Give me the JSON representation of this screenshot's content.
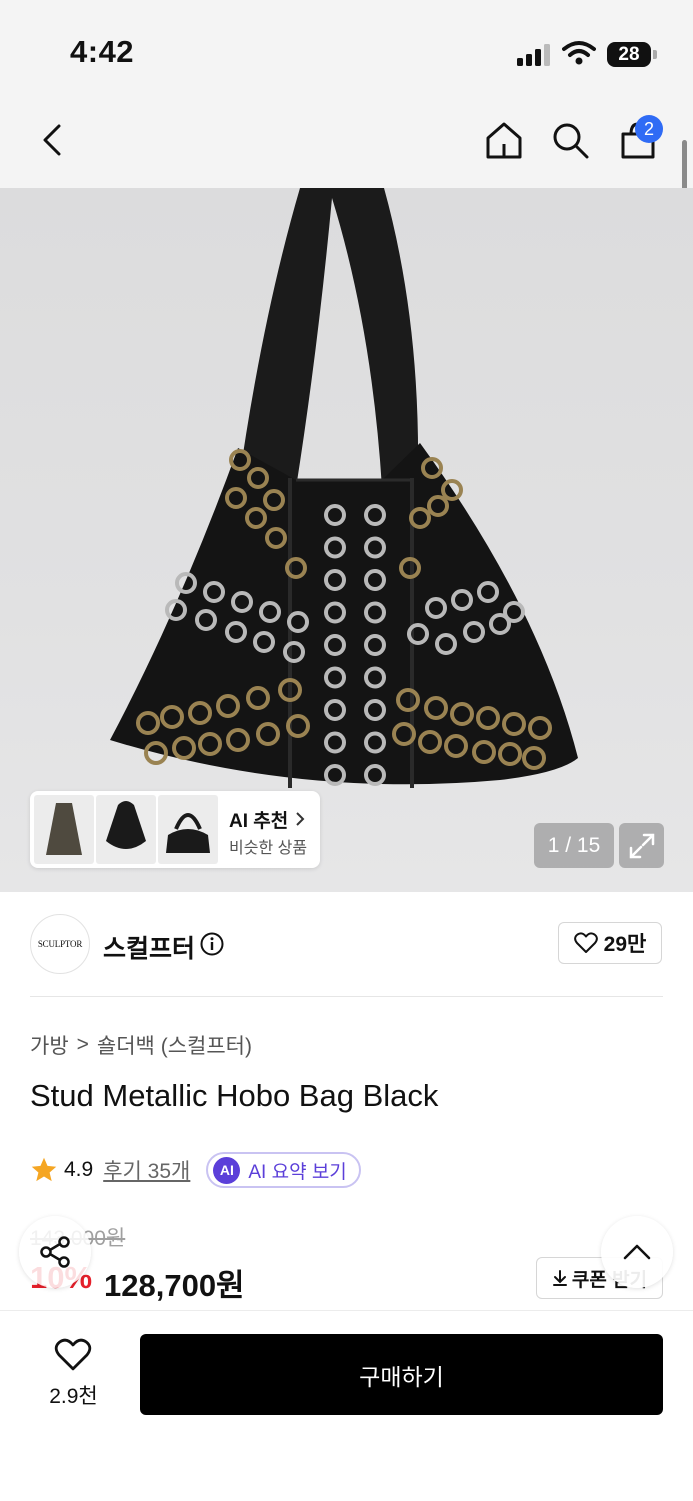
{
  "status_bar": {
    "time": "4:42",
    "battery": "28"
  },
  "nav": {
    "cart_count": "2"
  },
  "gallery": {
    "counter": "1 / 15",
    "ai_card": {
      "title": "AI 추천",
      "subtitle": "비슷한 상품"
    }
  },
  "brand": {
    "logo_text": "SCULPTOR",
    "name": "스컬프터",
    "likes": "29만"
  },
  "breadcrumb": {
    "category": "가방",
    "separator": ">",
    "subcategory": "숄더백 (스컬프터)"
  },
  "product": {
    "name": "Stud Metallic Hobo Bag Black",
    "rating": "4.9",
    "reviews_link": "후기 35개",
    "ai_summary": {
      "badge": "AI",
      "label": "AI 요약 보기"
    },
    "original_price": "143,000원",
    "discount": "10%",
    "price": "128,700원",
    "coupon_button": "쿠폰 받기"
  },
  "bottom_bar": {
    "wishlist_count": "2.9천",
    "buy_button": "구매하기"
  },
  "colors": {
    "accent_blue": "#2f6bf5",
    "ai_purple": "#5b3fd9",
    "discount_red": "#e5202b",
    "star": "#f5a623"
  }
}
